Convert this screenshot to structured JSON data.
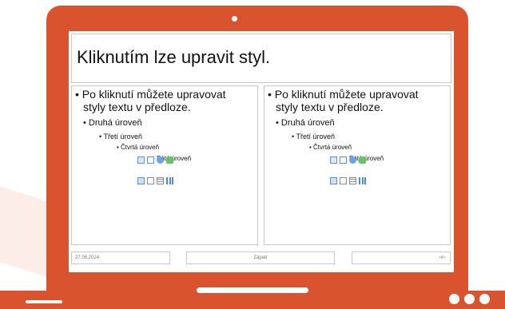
{
  "slide": {
    "title": "Kliknutím lze upravit styl.",
    "content_left": {
      "level1_line1": "• Po kliknutí můžete upravovat",
      "level1_line2": "styly textu v předloze.",
      "level2": "• Druhá úroveň",
      "level3": "• Třetí úroveň",
      "level4": "• Čtvrtá úroveň",
      "level5": "Pátá úroveň"
    },
    "content_right": {
      "level1_line1": "• Po kliknutí můžete upravovat",
      "level1_line2": "styly textu v předloze.",
      "level2": "• Druhá úroveň",
      "level3": "• Třetí úroveň",
      "level4": "• Čtvrtá úroveň",
      "level5": "Pátá úroveň"
    },
    "footer": {
      "date": "27.06.2024",
      "center": "Zápatí",
      "slide_number": "‹#›"
    }
  },
  "colors": {
    "laptop": "#d9532e",
    "screen": "#ffffff"
  }
}
